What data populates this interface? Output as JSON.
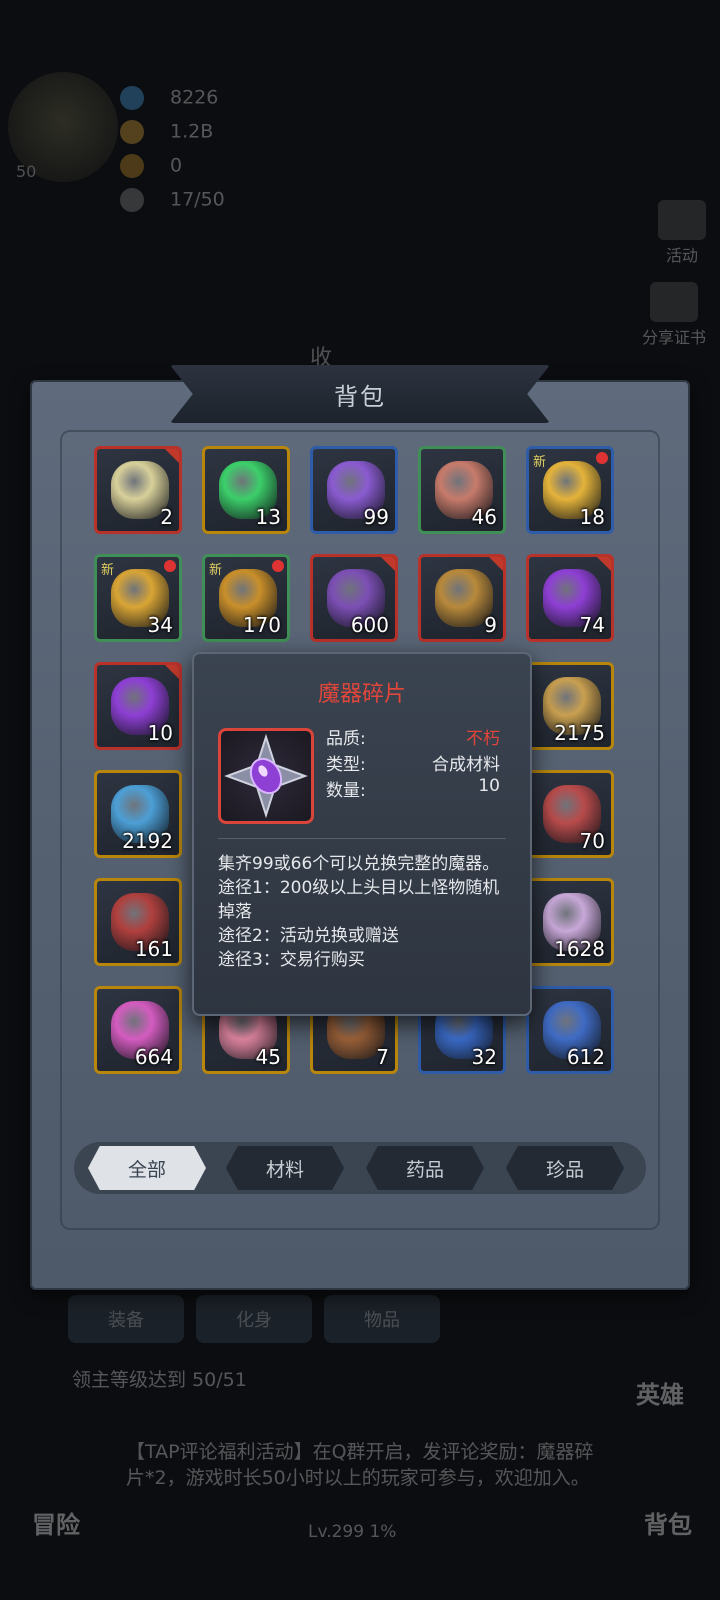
{
  "background": {
    "level": "50",
    "resources": [
      "8226",
      "1.2B",
      "0",
      "17/50"
    ],
    "side_buttons": [
      "活动",
      "分享证书"
    ],
    "harvest": "收",
    "tabs": [
      "装备",
      "化身",
      "物品"
    ],
    "quest": "领主等级达到 50/51",
    "news": "【TAP评论福利活动】在Q群开启，发评论奖励：魔器碎片*2，游戏时长50小时以上的玩家可参与，欢迎加入。",
    "level_progress": "Lv.299  1%",
    "left_button": "冒险",
    "right_button_top": "英雄",
    "right_button_bottom": "背包"
  },
  "bag": {
    "title": "背包",
    "new_label": "新",
    "items": [
      {
        "name": "white-potion",
        "count": "2",
        "frame": "red",
        "color": "#d8d09a"
      },
      {
        "name": "green-potion",
        "count": "13",
        "frame": "gold",
        "color": "#3ccf6a"
      },
      {
        "name": "purple-scroll",
        "count": "99",
        "frame": "blue",
        "color": "#8a5bd1"
      },
      {
        "name": "red-scroll",
        "count": "46",
        "frame": "green",
        "color": "#c77b6b"
      },
      {
        "name": "gold-bar",
        "count": "18",
        "frame": "blue",
        "color": "#e4b33a",
        "new": true,
        "dot": true
      },
      {
        "name": "gold-bar-small",
        "count": "34",
        "frame": "green",
        "color": "#d9a535",
        "new": true,
        "dot": true
      },
      {
        "name": "gold-pieces",
        "count": "170",
        "frame": "green",
        "color": "#c98f2a",
        "new": true,
        "dot": true
      },
      {
        "name": "demon-shield",
        "count": "600",
        "frame": "red",
        "color": "#7c4fb5"
      },
      {
        "name": "treasure-pot",
        "count": "9",
        "frame": "red",
        "color": "#b8893b"
      },
      {
        "name": "demon-shard",
        "count": "74",
        "frame": "red",
        "color": "#8e3fd4"
      },
      {
        "name": "demon-shard",
        "count": "10",
        "frame": "red",
        "color": "#8e3fd4"
      },
      {
        "name": "horn-ring",
        "count": "2175",
        "frame": "gold",
        "color": "#c9a050"
      },
      {
        "name": "blue-key",
        "count": "2192",
        "frame": "gold",
        "color": "#4c9fd6"
      },
      {
        "name": "red-ore",
        "count": "70",
        "frame": "gold",
        "color": "#b94b4b"
      },
      {
        "name": "red-ore-large",
        "count": "161",
        "frame": "gold",
        "color": "#b0403e"
      },
      {
        "name": "pink-crystal",
        "count": "1628",
        "frame": "gold",
        "color": "#c8a8d8"
      },
      {
        "name": "magic-flower",
        "count": "664",
        "frame": "gold",
        "color": "#d45cc0"
      },
      {
        "name": "pink-bun",
        "count": "45",
        "frame": "gold",
        "color": "#e88aa6"
      },
      {
        "name": "rune-scroll",
        "count": "7",
        "frame": "gold",
        "color": "#a0643a"
      },
      {
        "name": "blue-banner",
        "count": "32",
        "frame": "blue",
        "color": "#3c6fd0"
      },
      {
        "name": "lion-shield",
        "count": "612",
        "frame": "blue",
        "color": "#3f6bc4"
      }
    ],
    "categories": [
      "全部",
      "材料",
      "药品",
      "珍品"
    ]
  },
  "tooltip": {
    "title": "魔器碎片",
    "quality_label": "品质:",
    "quality_value": "不朽",
    "type_label": "类型:",
    "type_value": "合成材料",
    "count_label": "数量:",
    "count_value": "10",
    "desc_line1": "集齐99或66个可以兑换完整的魔器。",
    "desc_line2": "途径1：200级以上头目以上怪物随机掉落",
    "desc_line3": "途径2：活动兑换或赠送",
    "desc_line4": "途径3：交易行购买",
    "accent": "#e0463a"
  }
}
